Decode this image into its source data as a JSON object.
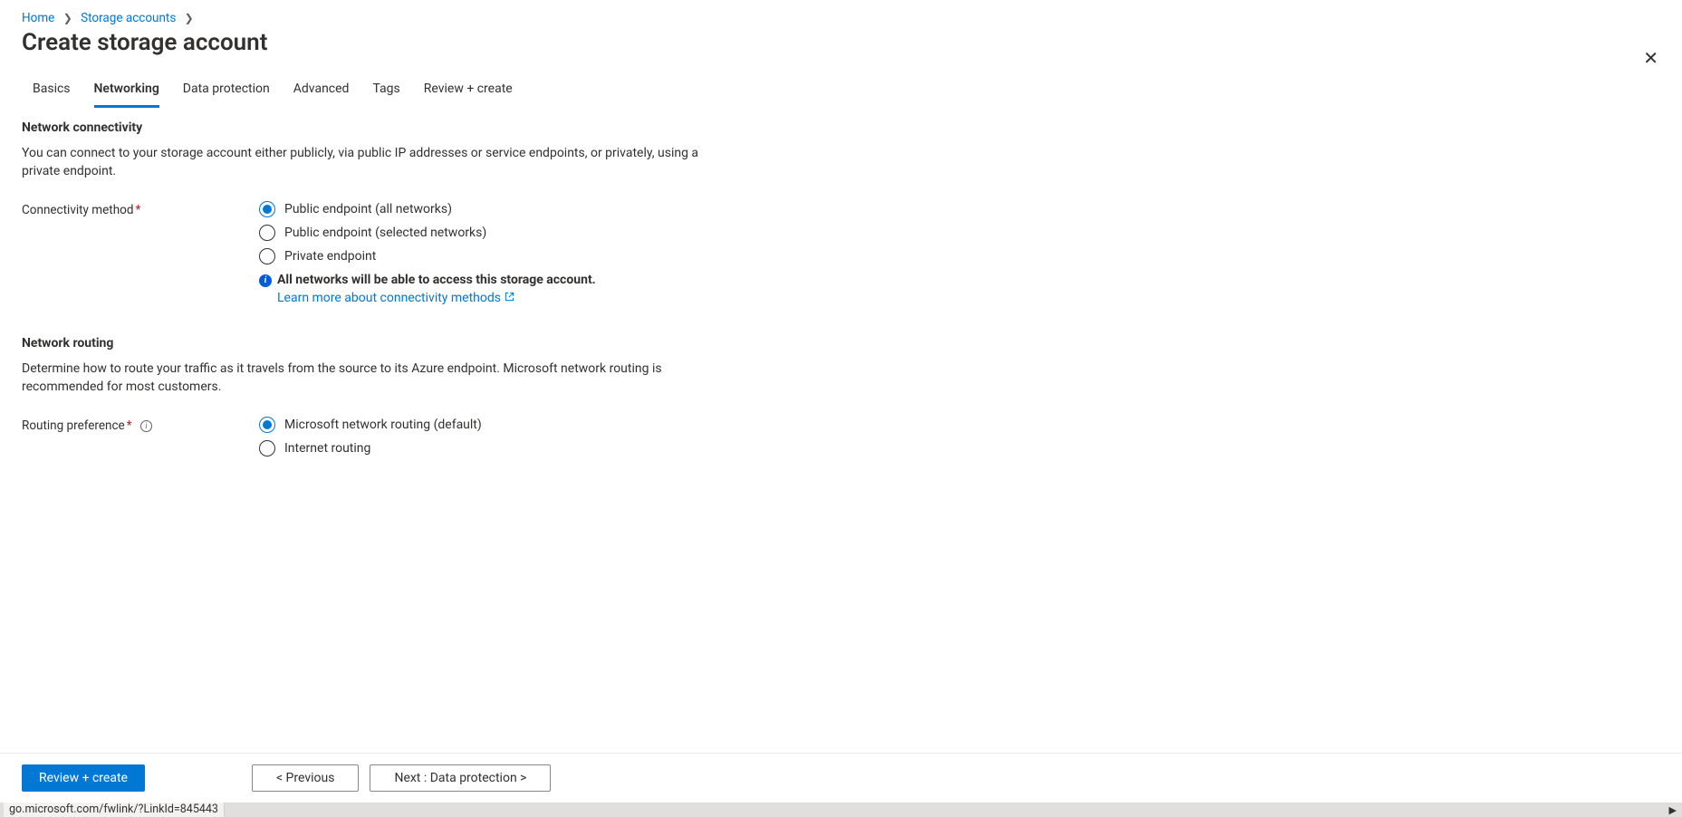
{
  "breadcrumb": {
    "home": "Home",
    "storage": "Storage accounts"
  },
  "page_title": "Create storage account",
  "tabs": [
    {
      "label": "Basics"
    },
    {
      "label": "Networking"
    },
    {
      "label": "Data protection"
    },
    {
      "label": "Advanced"
    },
    {
      "label": "Tags"
    },
    {
      "label": "Review + create"
    }
  ],
  "network_connectivity": {
    "heading": "Network connectivity",
    "description": "You can connect to your storage account either publicly, via public IP addresses or service endpoints, or privately, using a private endpoint.",
    "label": "Connectivity method",
    "options": [
      "Public endpoint (all networks)",
      "Public endpoint (selected networks)",
      "Private endpoint"
    ],
    "info_text": "All networks will be able to access this storage account.",
    "learn_more": "Learn more about connectivity methods"
  },
  "network_routing": {
    "heading": "Network routing",
    "description": "Determine how to route your traffic as it travels from the source to its Azure endpoint. Microsoft network routing is recommended for most customers.",
    "label": "Routing preference",
    "options": [
      "Microsoft network routing (default)",
      "Internet routing"
    ]
  },
  "footer": {
    "review": "Review + create",
    "previous": "<  Previous",
    "next": "Next : Data protection  >"
  },
  "status_url": "go.microsoft.com/fwlink/?LinkId=845443"
}
